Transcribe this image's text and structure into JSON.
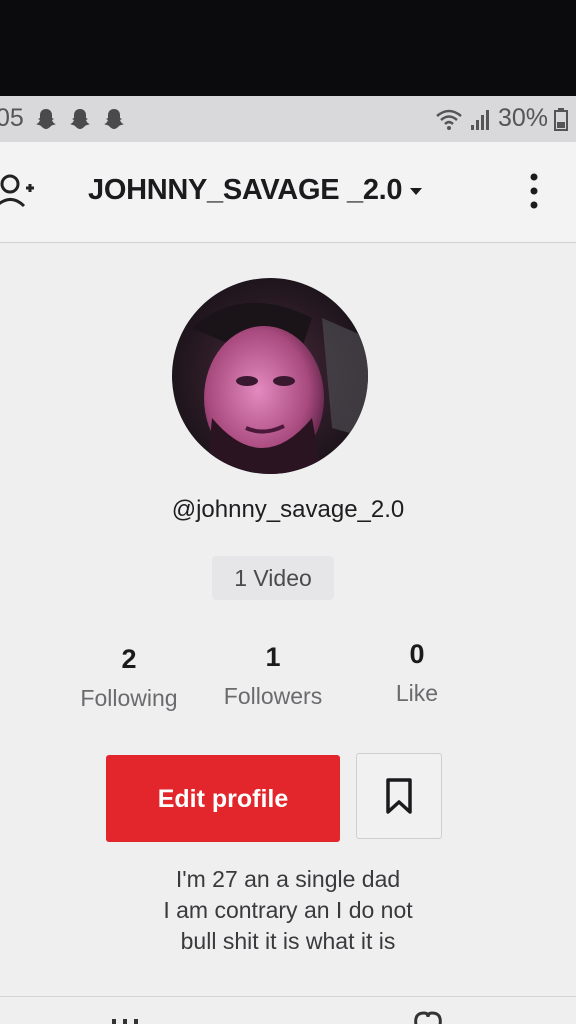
{
  "status_bar": {
    "time_partial": "05",
    "battery": "30%",
    "icons": [
      "snapchat-ghost-icon",
      "snapchat-ghost-icon",
      "snapchat-ghost-icon",
      "wifi-icon",
      "signal-icon",
      "battery-icon"
    ]
  },
  "header": {
    "title": "JOHNNY_SAVAGE _2.0",
    "add_user_icon": "add-user-icon",
    "dropdown_icon": "caret-down-icon",
    "menu_icon": "more-vertical-icon"
  },
  "profile": {
    "handle": "@johnny_savage_2.0",
    "video_count_label": "1 Video"
  },
  "stats": [
    {
      "value": "2",
      "label": "Following"
    },
    {
      "value": "1",
      "label": "Followers"
    },
    {
      "value": "0",
      "label": "Like"
    }
  ],
  "actions": {
    "edit_profile_label": "Edit profile",
    "bookmark_icon": "bookmark-icon"
  },
  "bio": {
    "line1": "I'm 27 an a single dad",
    "line2": "I am contrary an I do not",
    "line3": "bull shit it is what  it is"
  },
  "colors": {
    "accent_red": "#e2262c",
    "background": "#efeff0",
    "text_dark": "#1b1b1d"
  }
}
